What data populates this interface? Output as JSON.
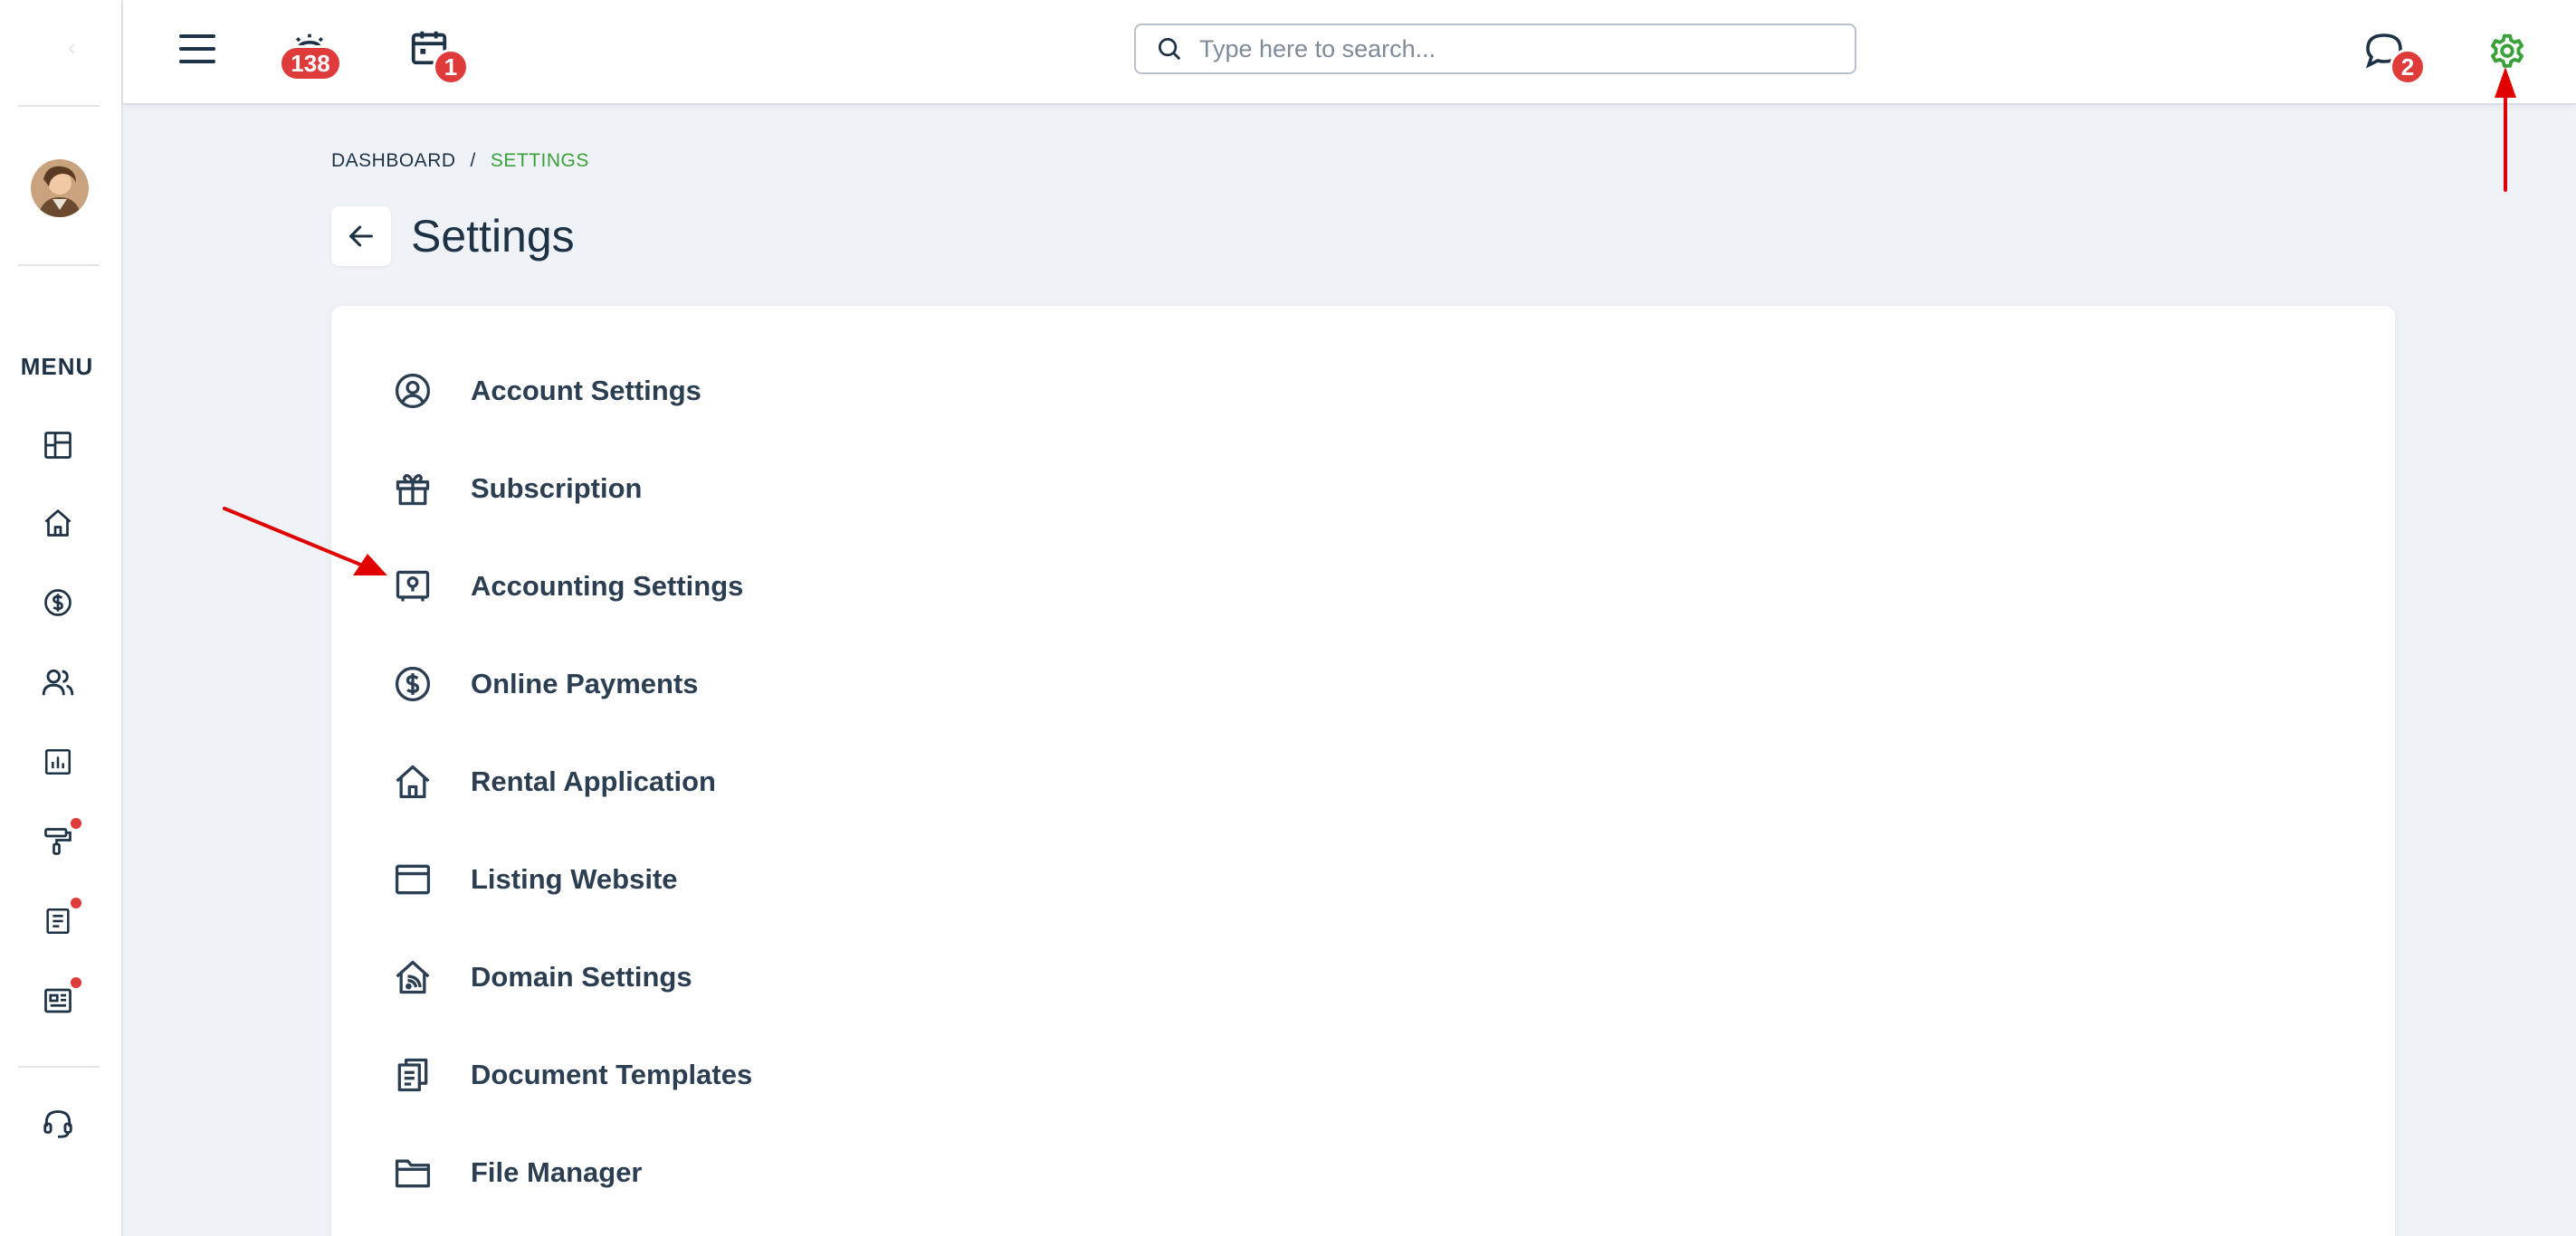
{
  "sidebar": {
    "menu_label": "MENU",
    "items": [
      {
        "name": "dashboard-icon"
      },
      {
        "name": "home-icon"
      },
      {
        "name": "dollar-icon"
      },
      {
        "name": "users-icon"
      },
      {
        "name": "reports-icon"
      },
      {
        "name": "paint-roller-icon",
        "notification_dot": true
      },
      {
        "name": "document-icon",
        "notification_dot": true
      },
      {
        "name": "newspaper-icon",
        "notification_dot": true
      },
      {
        "name": "support-headset-icon"
      }
    ]
  },
  "topbar": {
    "alarm_badge": "138",
    "calendar_badge": "1",
    "messages_badge": "2",
    "search_placeholder": "Type here to search...",
    "accent_color": "#3aa13a",
    "badge_color": "#e03b3b"
  },
  "breadcrumb": {
    "root": "DASHBOARD",
    "separator": "/",
    "current": "SETTINGS"
  },
  "page": {
    "title": "Settings"
  },
  "settings": {
    "items": [
      {
        "label": "Account Settings",
        "icon": "user-circle-icon"
      },
      {
        "label": "Subscription",
        "icon": "gift-icon"
      },
      {
        "label": "Accounting Settings",
        "icon": "safe-icon"
      },
      {
        "label": "Online Payments",
        "icon": "dollar-circle-icon"
      },
      {
        "label": "Rental Application",
        "icon": "house-icon"
      },
      {
        "label": "Listing Website",
        "icon": "browser-window-icon"
      },
      {
        "label": "Domain Settings",
        "icon": "house-signal-icon"
      },
      {
        "label": "Document Templates",
        "icon": "documents-icon"
      },
      {
        "label": "File Manager",
        "icon": "folder-icon"
      }
    ]
  }
}
